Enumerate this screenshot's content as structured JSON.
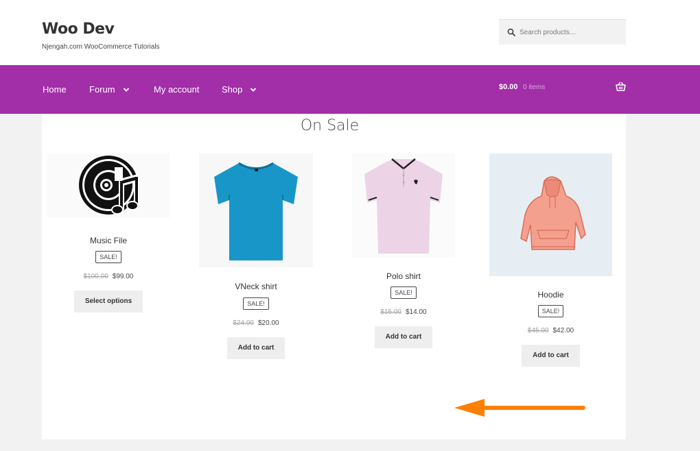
{
  "site": {
    "title": "Woo Dev",
    "description": "Njengah.com WooCommerce Tutorials"
  },
  "search": {
    "placeholder": "Search products…",
    "icon": "search-icon"
  },
  "nav": {
    "items": [
      {
        "label": "Home",
        "has_dropdown": false
      },
      {
        "label": "Forum",
        "has_dropdown": true
      },
      {
        "label": "My account",
        "has_dropdown": false
      },
      {
        "label": "Shop",
        "has_dropdown": true
      }
    ]
  },
  "cart": {
    "total": "$0.00",
    "count": "0 items",
    "icon": "basket-icon"
  },
  "section": {
    "title": "On Sale"
  },
  "products": [
    {
      "name": "Music File",
      "badge": "SALE!",
      "old_price": "$100.00",
      "price": "$99.00",
      "button": "Select options",
      "image": "music-file-icon"
    },
    {
      "name": "VNeck shirt",
      "badge": "SALE!",
      "old_price": "$24.00",
      "price": "$20.00",
      "button": "Add to cart",
      "image": "blue-tshirt-image"
    },
    {
      "name": "Polo shirt",
      "badge": "SALE!",
      "old_price": "$15.00",
      "price": "$14.00",
      "button": "Add to cart",
      "image": "pink-polo-image"
    },
    {
      "name": "Hoodie",
      "badge": "SALE!",
      "old_price": "$45.00",
      "price": "$42.00",
      "button": "Add to cart",
      "image": "hoodie-image"
    }
  ],
  "colors": {
    "nav_background": "#a22ea8",
    "page_background": "#f2f2f2",
    "annotation_arrow": "#ff7f00"
  }
}
